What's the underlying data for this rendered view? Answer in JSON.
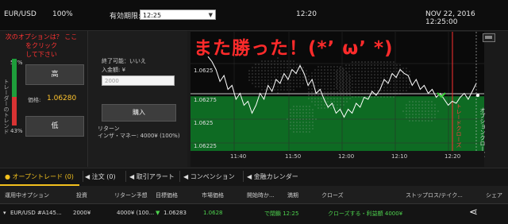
{
  "topbar": {
    "pair": "EUR/USD",
    "payout": "100%",
    "expiry_label": "有効期限:",
    "expiry_value": "12:25",
    "current_time": "12:20",
    "datetime": "NOV 22, 2016 12:25:00"
  },
  "left_panel": {
    "next_option_line1": "次のオプションは？ ここをクリック",
    "next_option_line2": "して下さい",
    "high_pct": "57%",
    "low_pct": "43%",
    "trader_label": "トレーダーのトレンド",
    "high_label": "高",
    "low_label": "低",
    "price_label": "価格:",
    "price_value": "1.06280"
  },
  "mid_panel": {
    "end_available": "終了可能：いいえ",
    "amount_label": "入金額: ¥",
    "amount_placeholder": "2000",
    "buy_label": "購入",
    "return_label": "リターン",
    "return_value": "インザ・マネー: 4000¥ (100%)"
  },
  "chart": {
    "overlay_text": "また勝った！(*’ ω’ *)",
    "option_close_label": "オプションクローズ",
    "trade_close_label": "トレードクローズ",
    "accent_color": "#ff2b2b",
    "up_zone_color": "#0e6b23",
    "down_zone_color": "#0a0a0a"
  },
  "chart_data": {
    "type": "line",
    "x_ticks": [
      "11:40",
      "11:50",
      "12:00",
      "12:10",
      "12:20"
    ],
    "y_ticks": [
      "1.0625",
      "1.06275",
      "1.0625",
      "1.06225"
    ],
    "strike": 1.06265,
    "ylim": [
      1.0621,
      1.0633
    ],
    "series": [
      {
        "values": [
          1.06305,
          1.063,
          1.06292,
          1.0628,
          1.06286,
          1.06272,
          1.06276,
          1.06262,
          1.06268,
          1.06256,
          1.0626,
          1.06248,
          1.06256,
          1.06268,
          1.06262,
          1.06276,
          1.0627,
          1.06282,
          1.06278,
          1.06288,
          1.06282,
          1.06292,
          1.06288,
          1.06296,
          1.06288,
          1.06276,
          1.06282,
          1.06268,
          1.06272,
          1.06262,
          1.06254,
          1.06258,
          1.06248,
          1.06252,
          1.06244,
          1.06252,
          1.06248,
          1.06258,
          1.06254,
          1.06264,
          1.06262,
          1.0627,
          1.06266,
          1.06272,
          1.06282,
          1.06278,
          1.06288,
          1.06284,
          1.06292,
          1.06288,
          1.06286,
          1.06276,
          1.06282,
          1.06272,
          1.06276,
          1.06268,
          1.06272,
          1.06264,
          1.06268,
          1.06262,
          1.06256,
          1.0626,
          1.06258,
          1.06264,
          1.06268,
          1.06262,
          1.0627,
          1.06278
        ]
      }
    ]
  },
  "tabs": [
    {
      "label": "オープントレード (0)"
    },
    {
      "label": "注文 (0)"
    },
    {
      "label": "取引アラート"
    },
    {
      "label": "コンベンション"
    },
    {
      "label": "金融カレンダー"
    }
  ],
  "table": {
    "headers": [
      "運用中オプション",
      "投資",
      "リターン予想",
      "目標価格",
      "市場価格",
      "開始時か...",
      "満期",
      "クローズ",
      "ストップロス/テイク...",
      "シェア"
    ],
    "row": {
      "option": "EUR/USD #A145...",
      "investment": "2000¥",
      "expected_return": "4000¥ (100...",
      "target_price": "1.06283",
      "market_price": "1.0628",
      "start": "",
      "expiry": "で閉鎖 12:25",
      "close": "クローズする・利益額 4000¥",
      "stoploss": ""
    }
  }
}
